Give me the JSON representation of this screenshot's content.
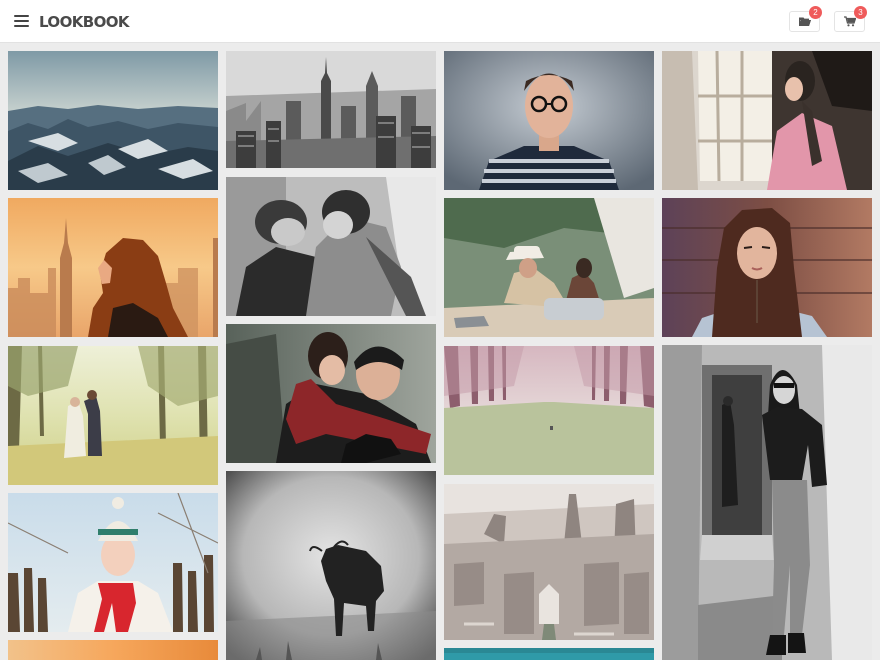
{
  "header": {
    "logo": "LOOKBOOK",
    "menu_icon": "hamburger-menu-icon",
    "folder": {
      "icon": "folder-open-icon",
      "count": "2"
    },
    "cart": {
      "icon": "shopping-cart-icon",
      "count": "3"
    }
  }
}
